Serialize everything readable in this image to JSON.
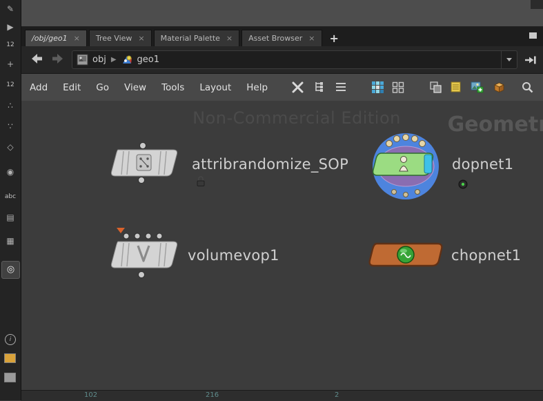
{
  "tabs": {
    "close": "×",
    "new_tab": "+",
    "items": [
      {
        "label": "/obj/geo1"
      },
      {
        "label": "Tree View"
      },
      {
        "label": "Material Palette"
      },
      {
        "label": "Asset Browser"
      }
    ]
  },
  "pathbar": {
    "network": "obj",
    "node": "geo1"
  },
  "menubar": {
    "items": [
      "Add",
      "Edit",
      "Go",
      "View",
      "Tools",
      "Layout",
      "Help"
    ]
  },
  "canvas": {
    "watermark": "Non-Commercial Edition",
    "pane_label": "Geometr",
    "nodes": [
      {
        "label": "attribrandomize_SOP"
      },
      {
        "label": "dopnet1"
      },
      {
        "label": "volumevop1"
      },
      {
        "label": "chopnet1"
      }
    ]
  },
  "sidebar": {
    "icons": {
      "pen": "✎",
      "select": "▶",
      "num_a": "12",
      "plus": "+",
      "num_b": "12",
      "dots_a": "∴",
      "dots_b": "∵",
      "diamond": "◇",
      "target": "◉",
      "abc": "abc",
      "thumb_a": "▤",
      "thumb_b": "▦",
      "pin": "◎",
      "info": "i"
    }
  },
  "bottom": {
    "ruler": [
      "102",
      "216",
      "2"
    ]
  },
  "colors": {
    "dop_blue": "#4d84de",
    "dop_purple": "#8a6db1",
    "node_green": "#9bdc82",
    "flag_cyan": "#3ec1e9",
    "chop_orange": "#bf6a33",
    "chop_green": "#37a337",
    "warning_orange": "#d9622b"
  }
}
